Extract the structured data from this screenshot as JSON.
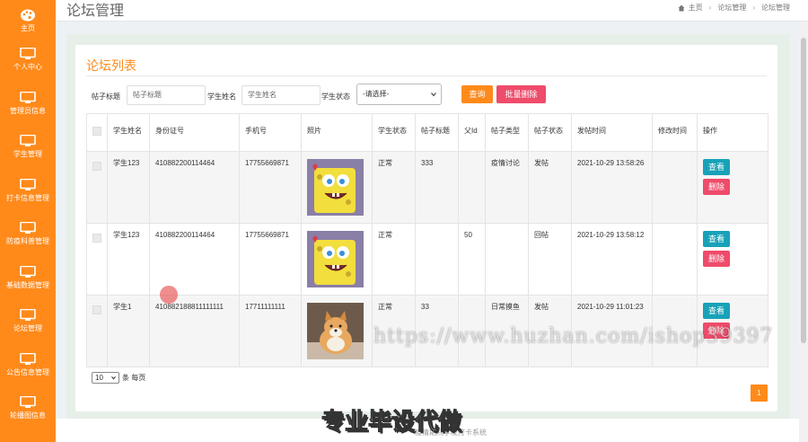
{
  "sidebar": {
    "items": [
      {
        "label": "主页",
        "icon": "palette-icon"
      },
      {
        "label": "个人中心",
        "icon": "monitor-icon"
      },
      {
        "label": "管理员信息",
        "icon": "monitor-icon"
      },
      {
        "label": "学生管理",
        "icon": "monitor-icon"
      },
      {
        "label": "打卡信息管理",
        "icon": "monitor-icon"
      },
      {
        "label": "防疫科普管理",
        "icon": "monitor-icon"
      },
      {
        "label": "基础数据管理",
        "icon": "monitor-icon"
      },
      {
        "label": "论坛管理",
        "icon": "monitor-icon"
      },
      {
        "label": "公告信息管理",
        "icon": "monitor-icon"
      },
      {
        "label": "轮播图信息",
        "icon": "monitor-icon"
      }
    ]
  },
  "header": {
    "title": "论坛管理",
    "breadcrumb": [
      "主页",
      "论坛管理",
      "论坛管理"
    ]
  },
  "panel": {
    "title": "论坛列表"
  },
  "filters": {
    "title_label": "帖子标题",
    "title_placeholder": "帖子标题",
    "name_label": "学生姓名",
    "name_placeholder": "学生姓名",
    "status_label": "学生状态",
    "status_selected": "-请选择-",
    "query_button": "查询",
    "batch_delete_button": "批量删除"
  },
  "table": {
    "headers": [
      "学生姓名",
      "身份证号",
      "手机号",
      "照片",
      "学生状态",
      "帖子标题",
      "父Id",
      "帖子类型",
      "帖子状态",
      "发帖时间",
      "修改时间",
      "操作"
    ],
    "rows": [
      {
        "name": "学生123",
        "id_card": "410882200114464",
        "phone": "17755669871",
        "photo": "spongebob",
        "status": "正常",
        "post_title": "333",
        "parent_id": "",
        "post_type": "疫情讨论",
        "post_status": "发帖",
        "post_time": "2021-10-29 13:58:26",
        "modify_time": "",
        "view_label": "查看",
        "delete_label": "删除"
      },
      {
        "name": "学生123",
        "id_card": "410882200114464",
        "phone": "17755669871",
        "photo": "spongebob",
        "status": "正常",
        "post_title": "",
        "parent_id": "50",
        "post_type": "",
        "post_status": "回帖",
        "post_time": "2021-10-29 13:58:12",
        "modify_time": "",
        "view_label": "查看",
        "delete_label": "删除"
      },
      {
        "name": "学生1",
        "id_card": "410882188811111111",
        "phone": "17711111111",
        "photo": "shiba-dog",
        "status": "正常",
        "post_title": "33",
        "parent_id": "",
        "post_type": "日常摸鱼",
        "post_status": "发帖",
        "post_time": "2021-10-29 11:01:23",
        "modify_time": "",
        "view_label": "查看",
        "delete_label": "删除"
      }
    ]
  },
  "pagination": {
    "page_size": "10",
    "page_size_suffix": "条 每页",
    "current_page": "1"
  },
  "footer": {
    "copyright": "疫情期间学校打卡系统"
  },
  "overlay": {
    "watermark": "https://www.huzhan.com/ishop39397",
    "caption": "专业毕设代做"
  },
  "colors": {
    "accent": "#ff8a1a",
    "danger": "#ef4b6a",
    "info": "#17a2b8"
  }
}
